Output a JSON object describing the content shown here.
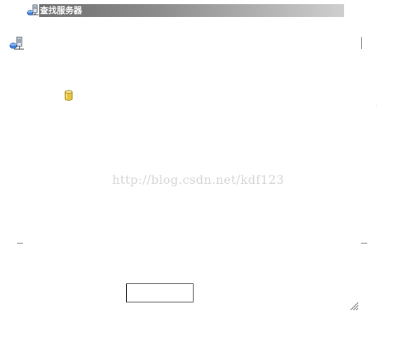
{
  "window": {
    "title": "查找服务器",
    "title_icon": "server-network-icon"
  },
  "content": {
    "server_icon": "server-network-icon",
    "database_icon": "database-icon"
  },
  "watermark": {
    "text": "http://blog.csdn.net/kdf123"
  },
  "footer": {
    "button_label": "",
    "resize_icon": "resize-grip-icon"
  },
  "colors": {
    "titlebar_dark": "#6f6f6f",
    "titlebar_light": "#cfcfcf",
    "database_yellow": "#e8c63a",
    "watermark": "#d6d6d6"
  }
}
